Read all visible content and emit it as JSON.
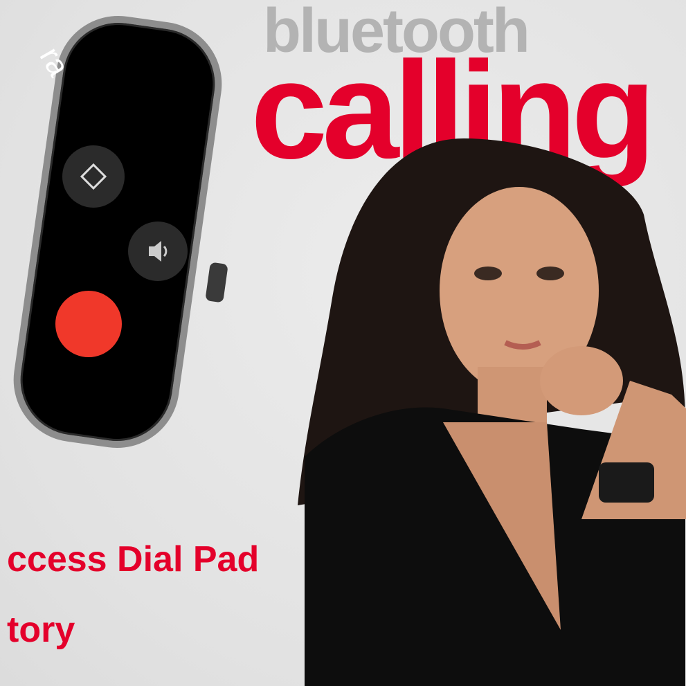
{
  "headline": {
    "top_word": "bluetooth",
    "main_word": "calling"
  },
  "watch_screen": {
    "brand_fragment": "ra",
    "icons": [
      "dialpad-icon",
      "volume-icon",
      "end-call-icon"
    ]
  },
  "features": [
    "ccess Dial Pad",
    "tory"
  ],
  "colors": {
    "brand_red": "#e4002b",
    "background": "#e6e6e6",
    "watch_body": "#000000",
    "end_call": "#f0382a"
  }
}
